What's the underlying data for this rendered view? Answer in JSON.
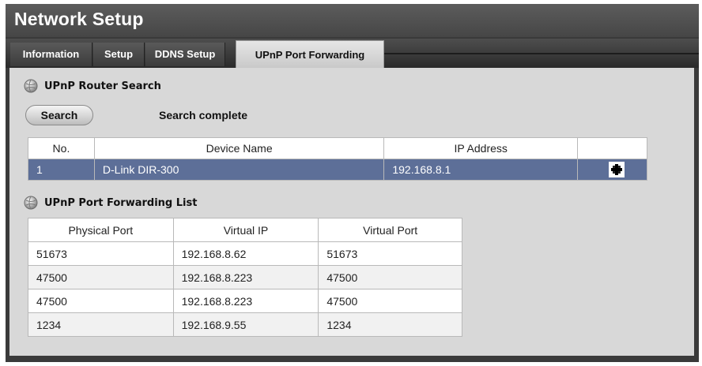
{
  "window": {
    "title": "Network Setup"
  },
  "tabs": [
    {
      "label": "Information"
    },
    {
      "label": "Setup"
    },
    {
      "label": "DDNS Setup"
    },
    {
      "label": "UPnP Port Forwarding",
      "active": true
    }
  ],
  "router_search": {
    "title": "UPnP Router Search",
    "search_label": "Search",
    "status": "Search complete",
    "columns": [
      "No.",
      "Device Name",
      "IP Address",
      ""
    ],
    "rows": [
      {
        "no": "1",
        "device_name": "D-Link DIR-300",
        "ip": "192.168.8.1",
        "action_icon": "plus-icon"
      }
    ]
  },
  "port_forwarding": {
    "title": "UPnP Port Forwarding List",
    "columns": [
      "Physical Port",
      "Virtual IP",
      "Virtual Port"
    ],
    "rows": [
      {
        "physical_port": "51673",
        "virtual_ip": "192.168.8.62",
        "virtual_port": "51673"
      },
      {
        "physical_port": "47500",
        "virtual_ip": "192.168.8.223",
        "virtual_port": "47500"
      },
      {
        "physical_port": "47500",
        "virtual_ip": "192.168.8.223",
        "virtual_port": "47500"
      },
      {
        "physical_port": "1234",
        "virtual_ip": "192.168.9.55",
        "virtual_port": "1234"
      }
    ]
  },
  "colors": {
    "selected_row": "#5d6f98",
    "panel_background": "#d8d8d8",
    "frame": "#3a3a3a"
  },
  "icons": {
    "section": "globe-icon",
    "row_action": "plus-icon"
  }
}
